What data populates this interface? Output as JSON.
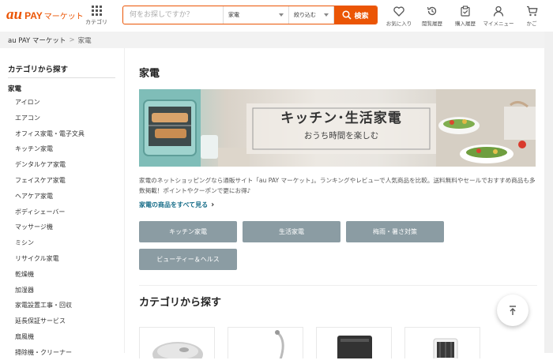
{
  "header": {
    "logo_au": "au",
    "logo_pay": "PAY",
    "logo_market": "マーケット",
    "category_label": "カテゴリ",
    "search_placeholder": "何をお探しですか？",
    "search_category": "家電",
    "search_filter": "絞り込む",
    "search_button": "検索",
    "icons": [
      {
        "name": "heart-icon",
        "label": "お気に入り"
      },
      {
        "name": "history-icon",
        "label": "閲覧履歴"
      },
      {
        "name": "purchase-history-icon",
        "label": "購入履歴"
      },
      {
        "name": "user-icon",
        "label": "マイメニュー"
      },
      {
        "name": "cart-icon",
        "label": "かご"
      }
    ]
  },
  "breadcrumb": {
    "root": "au PAY マーケット",
    "separator": ">",
    "current": "家電"
  },
  "sidebar": {
    "title": "カテゴリから探す",
    "parent": "家電",
    "items": [
      "アイロン",
      "エアコン",
      "オフィス家電・電子文具",
      "キッチン家電",
      "デンタルケア家電",
      "フェイスケア家電",
      "ヘアケア家電",
      "ボディシェーバー",
      "マッサージ機",
      "ミシン",
      "リサイクル家電",
      "乾燥機",
      "加湿器",
      "家電設置工事・回収",
      "延長保証サービス",
      "扇風機",
      "掃除機・クリーナー"
    ]
  },
  "main": {
    "title": "家電",
    "banner_title": "キッチン･生活家電",
    "banner_subtitle": "おうち時間を楽しむ",
    "description": "家電のネットショッピングなら通販サイト「au PAY マーケット」。ランキングやレビューで人気商品を比較。送料無料やセールでおすすめ商品も多数掲載！ポイントやクーポンで更にお得♪",
    "all_link": "家電の商品をすべて見る",
    "chips": [
      "キッチン家電",
      "生活家電",
      "梅雨・暑さ対策",
      "ビューティー＆ヘルス"
    ],
    "section2_title": "カテゴリから探す"
  },
  "colors": {
    "brand": "#eb5505",
    "chip": "#8b9ca3",
    "link": "#1a6f8a"
  }
}
